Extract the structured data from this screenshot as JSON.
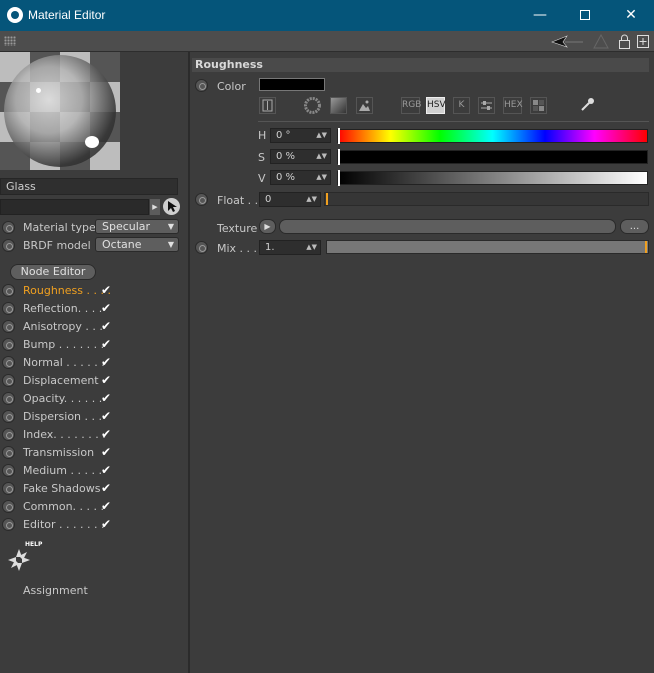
{
  "window": {
    "title": "Material Editor",
    "minimize": "—",
    "close": "✕"
  },
  "toolbar": {
    "back_icon": "arrow-left-icon",
    "lock_icon": "lock-icon",
    "add_icon": "plus-icon"
  },
  "material": {
    "name": "Glass",
    "material_type_label": "Material type",
    "material_type_value": "Specular",
    "brdf_label": "BRDF model",
    "brdf_value": "Octane",
    "node_editor_label": "Node Editor"
  },
  "channels": [
    {
      "label": "Roughness . . . .",
      "active": true,
      "checked": true
    },
    {
      "label": "Reflection. . . .",
      "active": false,
      "checked": true
    },
    {
      "label": "Anisotropy . . .",
      "active": false,
      "checked": true
    },
    {
      "label": "Bump . . . . . . .",
      "active": false,
      "checked": true
    },
    {
      "label": "Normal . . . . . .",
      "active": false,
      "checked": true
    },
    {
      "label": "Displacement",
      "active": false,
      "checked": true
    },
    {
      "label": "Opacity. . . . . .",
      "active": false,
      "checked": true
    },
    {
      "label": "Dispersion . . .",
      "active": false,
      "checked": true
    },
    {
      "label": "Index. . . . . . . .",
      "active": false,
      "checked": true
    },
    {
      "label": "Transmission",
      "active": false,
      "checked": true
    },
    {
      "label": "Medium . . . . .",
      "active": false,
      "checked": true
    },
    {
      "label": "Fake Shadows",
      "active": false,
      "checked": true
    },
    {
      "label": "Common. . . . .",
      "active": false,
      "checked": true
    },
    {
      "label": "Editor . . . . . . .",
      "active": false,
      "checked": true
    }
  ],
  "help_label": "HELP",
  "assignment_label": "Assignment",
  "section": {
    "title": "Roughness",
    "color_label": "Color",
    "color_value": "#000000",
    "mode_buttons": {
      "rgb": "RGB",
      "hsv": "HSV",
      "kelvin": "K",
      "hex": "HEX"
    },
    "h_label": "H",
    "h_value": "0 °",
    "s_label": "S",
    "s_value": "0 %",
    "v_label": "V",
    "v_value": "0 %",
    "float_label": "Float . .",
    "float_value": "0",
    "texture_label": "Texture",
    "texture_more": "...",
    "mix_label": "Mix . . .",
    "mix_value": "1."
  },
  "colors": {
    "titlebar": "#05557a",
    "accent": "#f0a020",
    "panel": "#3c3c3c"
  }
}
